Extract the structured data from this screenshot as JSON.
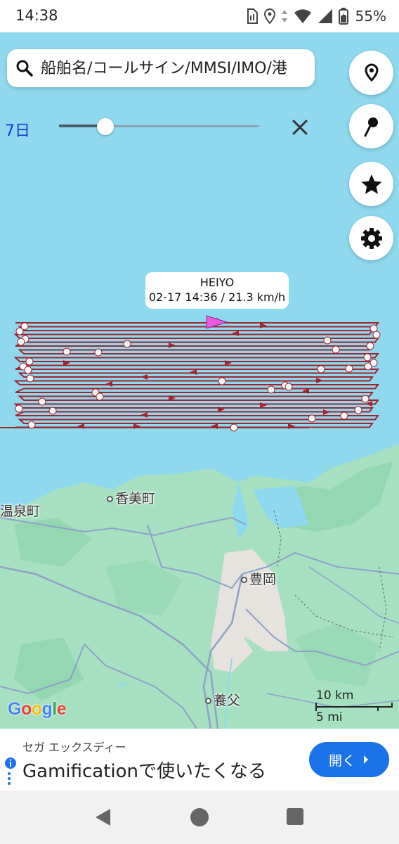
{
  "status_bar": {
    "time": "14:38",
    "battery": "55%"
  },
  "search": {
    "placeholder": "船舶名/コールサイン/MMSI/IMO/港"
  },
  "period": {
    "label": "7日",
    "slider_fraction": 0.23
  },
  "ship": {
    "name": "HEIYO",
    "info": "02-17 14:36 / 21.3 km/h",
    "track_color": "#a3242e",
    "marker_color": "#e95ce0"
  },
  "map": {
    "labels": {
      "kami": "香美町",
      "onsen": "温泉町",
      "toyooka": "豊岡",
      "yabu": "養父"
    },
    "sea_color": "#8fd9ee",
    "land_color": "#a7e0c0"
  },
  "google_logo": "Google",
  "scale": {
    "km": "10 km",
    "mi": "5 mi"
  },
  "ad": {
    "sponsor": "セガ エックスディー",
    "headline": "Gamificationで使いたくなる",
    "open_label": "開く"
  },
  "fab_icons": [
    "location-pin-icon",
    "map-pin-icon",
    "star-icon",
    "settings-gear-icon"
  ]
}
